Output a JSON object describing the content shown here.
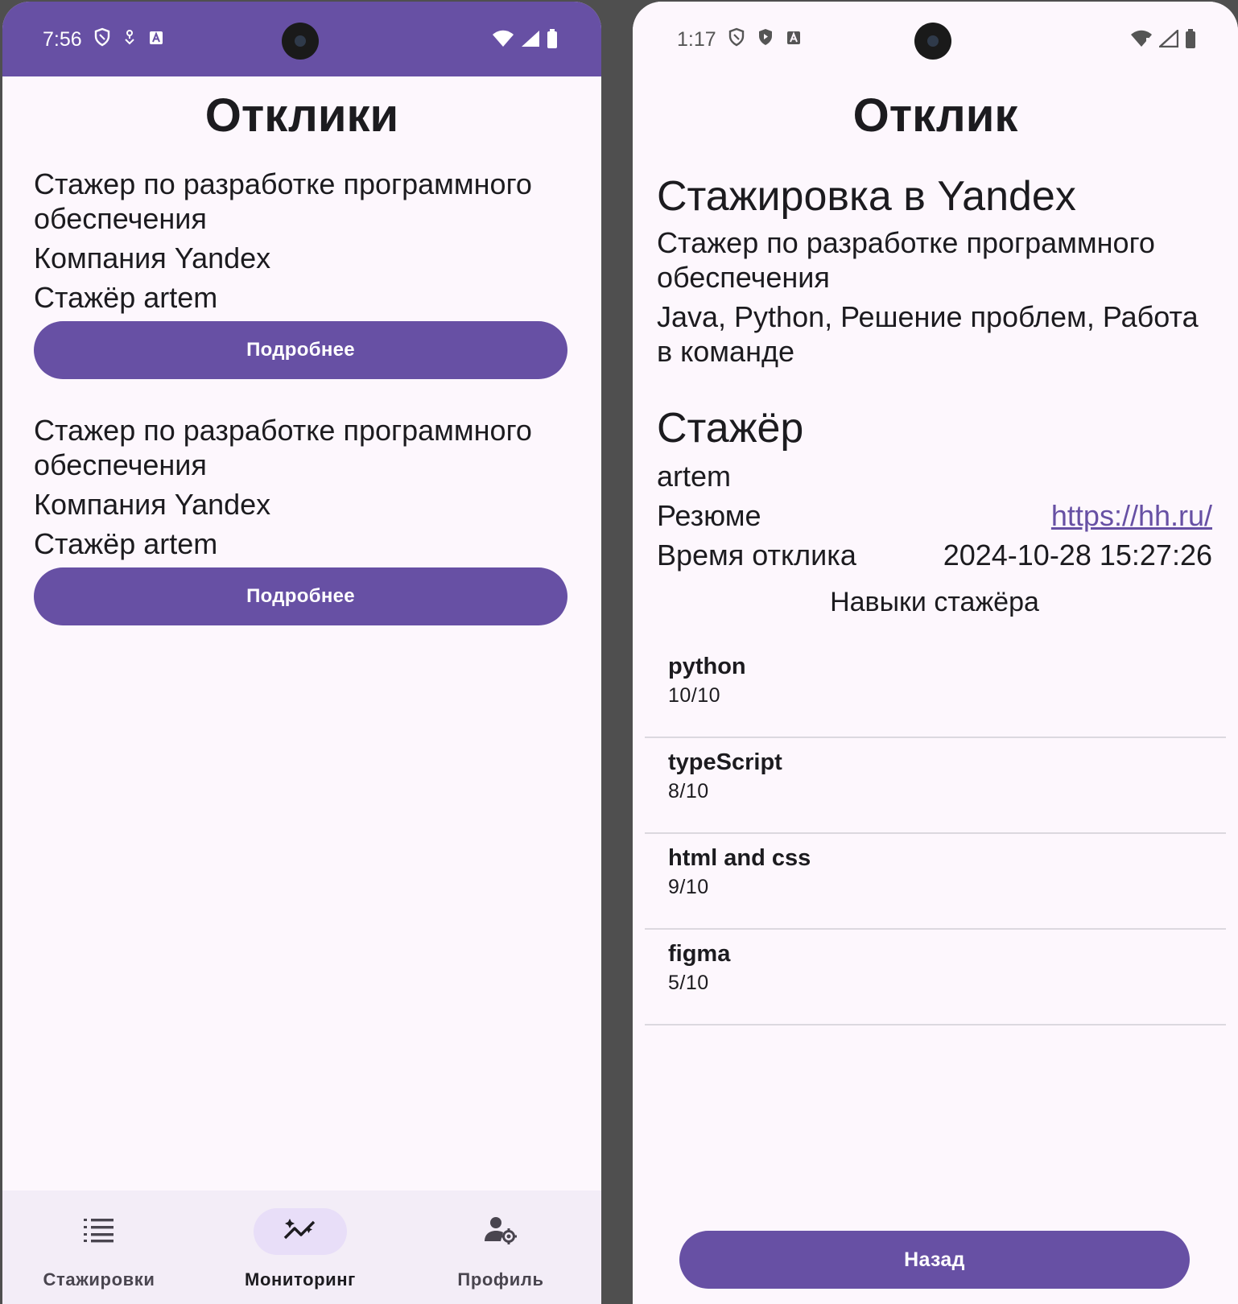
{
  "left": {
    "status": {
      "time": "7:56"
    },
    "title": "Отклики",
    "responses": [
      {
        "position": "Стажер по разработке программного обеспечения",
        "company": "Компания Yandex",
        "intern": "Стажёр artem",
        "button": "Подробнее"
      },
      {
        "position": "Стажер по разработке программного обеспечения",
        "company": "Компания Yandex",
        "intern": "Стажёр artem",
        "button": "Подробнее"
      }
    ],
    "nav": [
      {
        "label": "Стажировки",
        "icon": "list-icon",
        "active": false
      },
      {
        "label": "Мониторинг",
        "icon": "monitoring-chart-icon",
        "active": true
      },
      {
        "label": "Профиль",
        "icon": "profile-settings-icon",
        "active": false
      }
    ]
  },
  "right": {
    "status": {
      "time": "1:17"
    },
    "title": "Отклик",
    "vacancy": {
      "title": "Стажировка в Yandex",
      "position": "Стажер по разработке программного обеспечения",
      "skills_required": "Java, Python, Решение проблем, Работа в команде"
    },
    "intern": {
      "heading": "Стажёр",
      "name": "artem",
      "resume_label": "Резюме",
      "resume_link": "https://hh.ru/",
      "time_label": "Время отклика",
      "time_value": "2024-10-28 15:27:26",
      "skills_heading": "Навыки стажёра",
      "skills": [
        {
          "name": "python",
          "score": "10/10"
        },
        {
          "name": "typeScript",
          "score": "8/10"
        },
        {
          "name": "html and css",
          "score": "9/10"
        },
        {
          "name": "figma",
          "score": "5/10"
        }
      ]
    },
    "back_button": "Назад"
  },
  "colors": {
    "primary": "#6750a4",
    "background": "#fdf7fd",
    "nav_background": "#f3edf7",
    "nav_indicator": "#e8def8"
  }
}
